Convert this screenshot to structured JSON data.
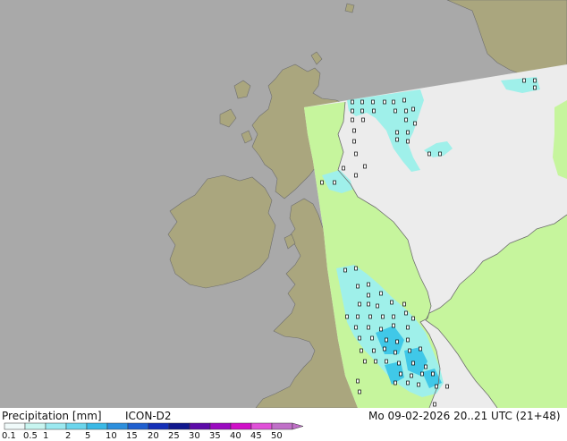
{
  "map": {
    "colors": {
      "sea": "#a9a9a9",
      "land": "#aaa67e",
      "model_domain": "#ececec",
      "precip_light": "#c6f59d",
      "precip_medium": "#9ff0ea",
      "precip_blue": "#40c8e8",
      "coast": "#6e6e6e"
    }
  },
  "footer": {
    "title": "Precipitation [mm]",
    "model": "ICON-D2",
    "valid_time": "Mo 09-02-2026 20..21 UTC (21+48)"
  },
  "legend": {
    "ticks": [
      "0.1",
      "0.5",
      "1",
      "2",
      "5",
      "10",
      "15",
      "20",
      "25",
      "30",
      "35",
      "40",
      "45",
      "50"
    ],
    "colors": [
      "#f0fafa",
      "#c8f5f0",
      "#9be9f0",
      "#6bd5ec",
      "#3ab9e6",
      "#2c8fdd",
      "#2060d0",
      "#1530b8",
      "#10188e",
      "#5c0aa8",
      "#9a0ac0",
      "#d010c8",
      "#e050d8",
      "#c070c8"
    ]
  }
}
